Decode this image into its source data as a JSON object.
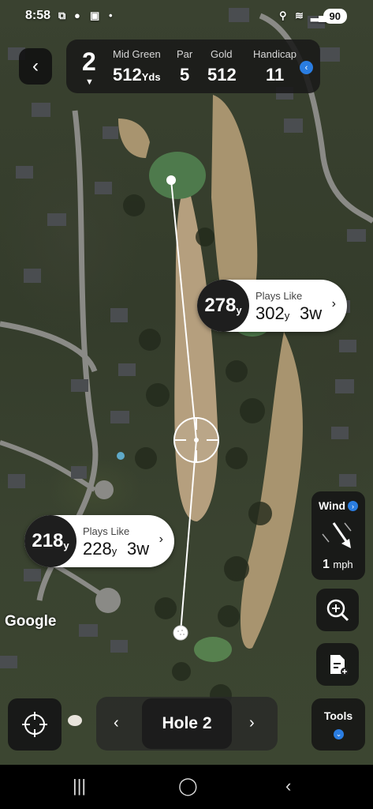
{
  "status_bar": {
    "time": "8:58",
    "battery": "90"
  },
  "header": {
    "back_icon": "chevron-left-icon",
    "hole_number": "2",
    "distance_label": "Mid Green",
    "distance_value": "512",
    "distance_unit": "Yds",
    "par_label": "Par",
    "par_value": "5",
    "tee_label": "Gold",
    "tee_value": "512",
    "handicap_label": "Handicap",
    "handicap_value": "11",
    "expand_icon": "chevron-left-icon"
  },
  "callouts": {
    "upper": {
      "distance": "278",
      "unit": "y",
      "label": "Plays Like",
      "plays_like": "302",
      "plays_unit": "y",
      "club": "3w"
    },
    "lower": {
      "distance": "218",
      "unit": "y",
      "label": "Plays Like",
      "plays_like": "228",
      "plays_unit": "y",
      "club": "3w"
    }
  },
  "wind": {
    "label": "Wind",
    "speed": "1",
    "unit": "mph",
    "direction_icon": "arrow-down-right-icon"
  },
  "controls": {
    "zoom_icon": "zoom-in-icon",
    "scorecard_icon": "scorecard-add-icon",
    "locate_icon": "crosshair-icon"
  },
  "tools": {
    "label": "Tools"
  },
  "hole_nav": {
    "label": "Hole 2"
  },
  "map": {
    "attribution": "Google"
  },
  "colors": {
    "accent": "#2a7de1",
    "panel": "#161616"
  }
}
